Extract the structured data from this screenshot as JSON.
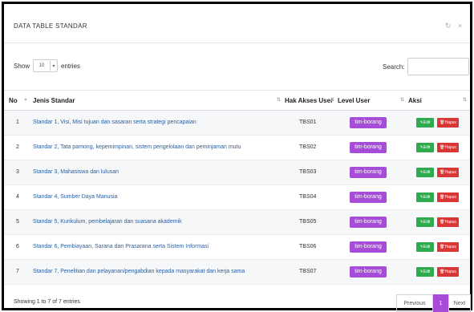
{
  "panel": {
    "title": "DATA TABLE STANDAR",
    "refresh_icon": "refresh-icon",
    "close_icon": "close-icon"
  },
  "length": {
    "show_label": "Show",
    "value": "10",
    "entries_label": "entries"
  },
  "search": {
    "label": "Search:",
    "value": ""
  },
  "columns": [
    "No",
    "Jenis Standar",
    "Hak Akses User",
    "Level User",
    "Aksi"
  ],
  "rows": [
    {
      "no": "1",
      "jenis": "Standar 1, Visi, Misi tujuan dan sasaran serta strategi pencapaian",
      "hak": "TBS01",
      "level": "tim-borang",
      "edit": "Edit",
      "hapus": "Hapus"
    },
    {
      "no": "2",
      "jenis": "Standar 2, Tata pamong, kepemimpinan, sistem pengelolaan dan peminjaman mutu",
      "hak": "TBS02",
      "level": "tim-borang",
      "edit": "Edit",
      "hapus": "Hapus"
    },
    {
      "no": "3",
      "jenis": "Standar 3, Mahasiswa dan lulusan",
      "hak": "TBS03",
      "level": "tim-borang",
      "edit": "Edit",
      "hapus": "Hapus"
    },
    {
      "no": "4",
      "jenis": "Standar 4, Sumber Daya Manusia",
      "hak": "TBS04",
      "level": "tim-borang",
      "edit": "Edit",
      "hapus": "Hapus"
    },
    {
      "no": "5",
      "jenis": "Standar 5, Kurikulum, pembelajaran dan suasana akademik",
      "hak": "TBS05",
      "level": "tim-borang",
      "edit": "Edit",
      "hapus": "Hapus"
    },
    {
      "no": "6",
      "jenis": "Standar 6, Pembiayaan, Sarana dan Prasarana serta Sistem Informasi",
      "hak": "TBS06",
      "level": "tim-borang",
      "edit": "Edit",
      "hapus": "Hapus"
    },
    {
      "no": "7",
      "jenis": "Standar 7, Penelitian dan pelayanan/pengabdian kepada masyarakat dan kerja sama",
      "hak": "TBS07",
      "level": "tim-borang",
      "edit": "Edit",
      "hapus": "Hapus"
    }
  ],
  "footer": {
    "info": "Showing 1 to 7 of 7 entries",
    "previous": "Previous",
    "current_page": "1",
    "next": "Next"
  },
  "colors": {
    "accent": "#a64cd8",
    "edit": "#2eaa4f",
    "delete": "#d93636",
    "link": "#2b5f9e"
  }
}
